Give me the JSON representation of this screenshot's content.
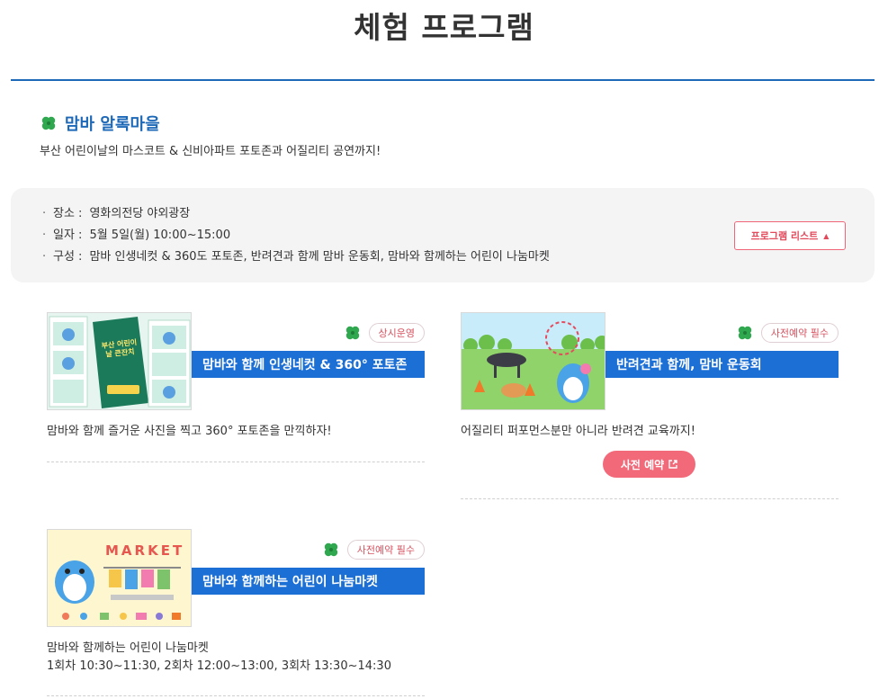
{
  "page": {
    "title": "체험 프로그램"
  },
  "section": {
    "title": "맘바 알록마을",
    "description": "부산 어린이날의 마스코트 & 신비아파트 포토존과 어질리티 공연까지!"
  },
  "info": {
    "items": [
      {
        "label": "장소 :",
        "value": "영화의전당 야외광장"
      },
      {
        "label": "일자 :",
        "value": "5월 5일(월) 10:00~15:00"
      },
      {
        "label": "구성 :",
        "value": "맘바 인생네컷 & 360도 포토존, 반려견과 함께 맘바 운동회, 맘바와 함께하는 어린이 나눔마켓"
      }
    ],
    "program_list_button": "프로그램 리스트"
  },
  "cards": [
    {
      "badge": "상시운영",
      "title": "맘바와 함께 인생네컷 & 360° 포토존",
      "description": "맘바와 함께 즐거운 사진을 찍고 360° 포토존을 만끽하자!",
      "thumb_text": "부산 어린이날 큰잔치"
    },
    {
      "badge": "사전예약 필수",
      "title": "반려견과 함께, 맘바 운동회",
      "description": "어질리티 퍼포먼스분만 아니라 반려견 교육까지!",
      "button": "사전 예약"
    },
    {
      "badge": "사전예약 필수",
      "title": "맘바와 함께하는 어린이 나눔마켓",
      "description_line1": "맘바와 함께하는 어린이 나눔마켓",
      "description_line2": "1회차 10:30~11:30, 2회차 12:00~13:00, 3회차 13:30~14:30",
      "thumb_text": "MARKET"
    }
  ],
  "colors": {
    "accent": "#1d69b8",
    "bar": "#1c6fd5",
    "pink": "#f26a7a"
  },
  "icons": {
    "section": "clover-icon",
    "badge": "clover-icon",
    "external": "external-link-icon",
    "toggle": "triangle-up-icon"
  }
}
